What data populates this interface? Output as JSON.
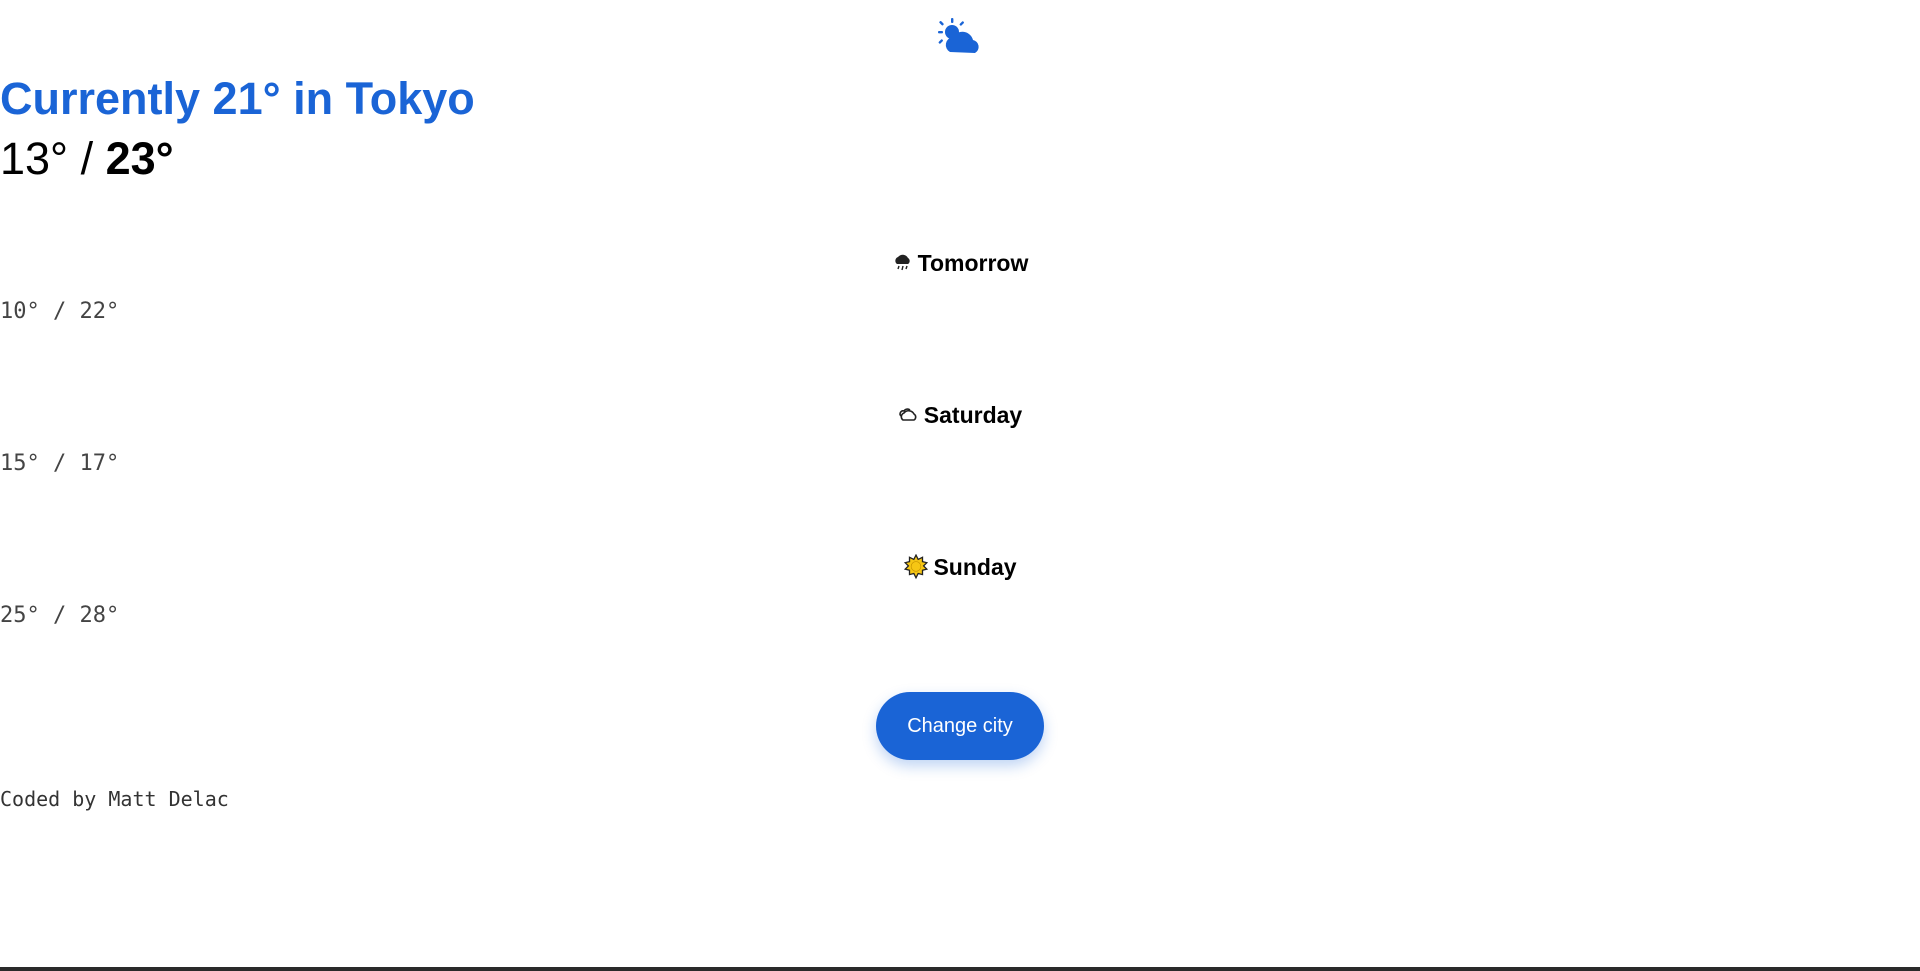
{
  "current": {
    "title": "Currently 21° in Tokyo",
    "low": "13°",
    "separator": " / ",
    "high": "23°",
    "icon": "sun-behind-cloud-icon"
  },
  "forecast": [
    {
      "day": "Tomorrow",
      "temps": "10° / 22°",
      "icon": "rain-cloud-icon"
    },
    {
      "day": "Saturday",
      "temps": "15° / 17°",
      "icon": "cloud-icon"
    },
    {
      "day": "Sunday",
      "temps": "25° / 28°",
      "icon": "sun-icon"
    }
  ],
  "actions": {
    "change_city_label": "Change city"
  },
  "footer": {
    "text": "Coded by Matt Delac"
  },
  "colors": {
    "accent": "#1a64d6"
  }
}
